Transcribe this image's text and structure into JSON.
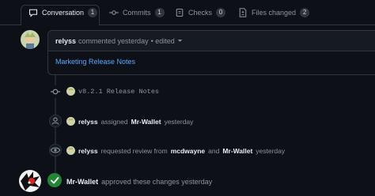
{
  "tabs": [
    {
      "label": "Conversation",
      "count": "1",
      "icon": "comment-icon"
    },
    {
      "label": "Commits",
      "count": "1",
      "icon": "commit-icon"
    },
    {
      "label": "Checks",
      "count": "0",
      "icon": "checks-icon"
    },
    {
      "label": "Files changed",
      "count": "2",
      "icon": "file-diff-icon"
    }
  ],
  "comment": {
    "author": "relyss",
    "meta": "commented yesterday",
    "edited": "• edited",
    "body": "Marketing Release Notes"
  },
  "events": {
    "commit": "v8.2.1 Release Notes",
    "assign": {
      "actor": "relyss",
      "verb": "assigned",
      "target": "Mr-Wallet",
      "time": "yesterday"
    },
    "review_request": {
      "actor": "relyss",
      "verb": "requested review from",
      "target1": "mcdwayne",
      "and": "and",
      "target2": "Mr-Wallet",
      "time": "yesterday"
    },
    "approval": {
      "actor": "Mr-Wallet",
      "text": "approved these changes yesterday"
    }
  },
  "colors": {
    "background": "#0d1117",
    "border": "#30363d",
    "link": "#58a6ff",
    "approved": "#238636"
  }
}
